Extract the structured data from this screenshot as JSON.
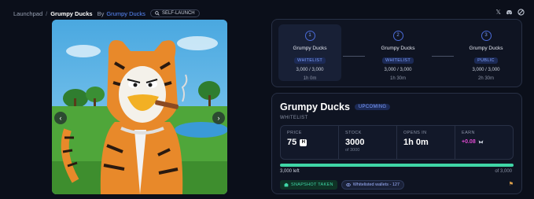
{
  "breadcrumb": {
    "root": "Launchpad",
    "separator": "/",
    "current": "Grumpy Ducks",
    "by_label": "By",
    "creator": "Grumpy Ducks",
    "badge": "SELF-LAUNCH"
  },
  "social_icons": [
    "x-icon",
    "discord-icon",
    "globe-icon"
  ],
  "phases": [
    {
      "number": "1",
      "name": "Grumpy Ducks",
      "tag": "WHITELIST",
      "count": "3,000 / 3,000",
      "time": "1h 0m",
      "active": true
    },
    {
      "number": "2",
      "name": "Grumpy Ducks",
      "tag": "WHITELIST",
      "count": "3,000 / 3,000",
      "time": "1h 30m",
      "active": false
    },
    {
      "number": "3",
      "name": "Grumpy Ducks",
      "tag": "PUBLIC",
      "count": "3,000 / 3,000",
      "time": "2h 30m",
      "active": false
    }
  ],
  "info": {
    "title": "Grumpy Ducks",
    "status": "UPCOMING",
    "phase_label": "WHITELIST",
    "stats": {
      "price_label": "PRICE",
      "price_value": "75",
      "currency_symbol": "H",
      "stock_label": "STOCK",
      "stock_value": "3000",
      "stock_sub": "of 3000",
      "opens_label": "OPENS IN",
      "opens_value": "1h 0m",
      "earn_label": "EARN",
      "earn_value": "+0.08"
    },
    "progress_fraction": 1.0,
    "left_text": "3,000 left",
    "of_text": "of 3,000",
    "chip_snapshot": "SNAPSHOT TAKEN",
    "chip_whitelist": "Whitelisted wallets - 127"
  },
  "colors": {
    "accent": "#5b8cff",
    "progress": "#3fd6a6",
    "earn": "#e04ad2",
    "background": "#0b0f1a"
  }
}
